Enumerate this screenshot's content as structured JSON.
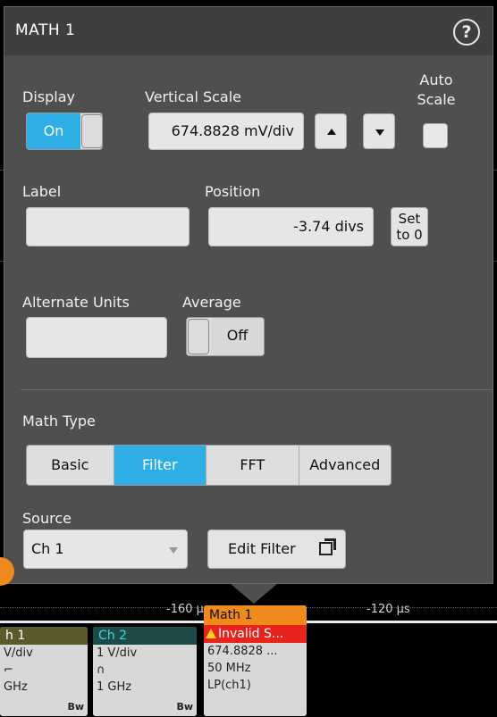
{
  "panel": {
    "title": "MATH 1",
    "help_icon": "help-circle-icon"
  },
  "display": {
    "label": "Display",
    "toggle_value": "On"
  },
  "vertical_scale": {
    "label": "Vertical Scale",
    "value": "674.8828 mV/div"
  },
  "auto_scale": {
    "label_line1": "Auto",
    "label_line2": "Scale",
    "checked": false
  },
  "label_field": {
    "label": "Label",
    "value": ""
  },
  "position": {
    "label": "Position",
    "value": "-3.74 divs",
    "set_to_zero_line1": "Set",
    "set_to_zero_line2": "to 0"
  },
  "alternate_units": {
    "label": "Alternate Units",
    "value": ""
  },
  "average": {
    "label": "Average",
    "toggle_value": "Off"
  },
  "math_type": {
    "label": "Math Type",
    "options": [
      "Basic",
      "Filter",
      "FFT",
      "Advanced"
    ],
    "selected": "Filter"
  },
  "source": {
    "label": "Source",
    "selected": "Ch 1",
    "edit_filter_label": "Edit Filter"
  },
  "timeline": {
    "left_label": "-160 µ",
    "right_label": "-120 µs"
  },
  "channels": [
    {
      "name": "h 1",
      "line1": "V/div",
      "line2": "",
      "line3": "GHz",
      "bw": "Bw",
      "head_color": "#5a5a2a"
    },
    {
      "name": "Ch 2",
      "line1": "1 V/div",
      "line2": "",
      "line3": "1 GHz",
      "bw": "Bw",
      "head_color": "#1f4a4a",
      "head_text_color": "#3fd6d6"
    }
  ],
  "math_card": {
    "name": "Math 1",
    "warning": "Invalid S...",
    "line1": "674.8828 ...",
    "line2": "50 MHz",
    "line3": "LP(ch1)"
  },
  "colors": {
    "accent": "#2eaee4",
    "math_orange": "#f08a1c",
    "warning_red": "#e8231c"
  }
}
